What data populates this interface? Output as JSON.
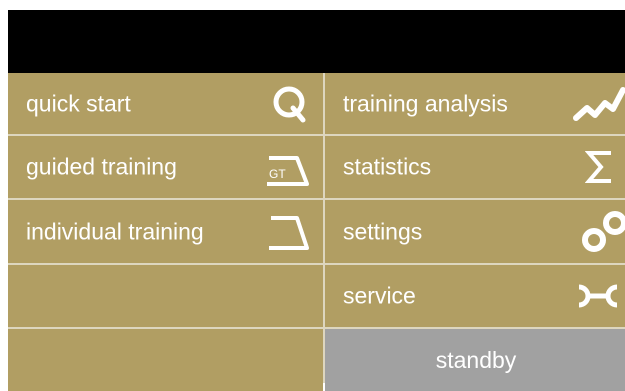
{
  "left_menu": {
    "items": [
      {
        "label": "quick start",
        "icon": "quick-start-q-icon"
      },
      {
        "label": "guided training",
        "icon": "guided-training-gt-icon",
        "icon_text": "GT"
      },
      {
        "label": "individual training",
        "icon": "individual-training-profile-icon"
      },
      {
        "label": "",
        "icon": ""
      },
      {
        "label": "",
        "icon": ""
      }
    ]
  },
  "right_menu": {
    "items": [
      {
        "label": "training analysis",
        "icon": "training-analysis-graph-icon"
      },
      {
        "label": "statistics",
        "icon": "sigma-icon"
      },
      {
        "label": "settings",
        "icon": "settings-circles-icon"
      },
      {
        "label": "service",
        "icon": "wrench-icon"
      },
      {
        "label": "standby",
        "icon": ""
      }
    ]
  },
  "colors": {
    "tile": "#b19e63",
    "standby": "#a1a1a1",
    "header": "#000000",
    "divider": "#ddd6bf",
    "text": "#ffffff"
  }
}
